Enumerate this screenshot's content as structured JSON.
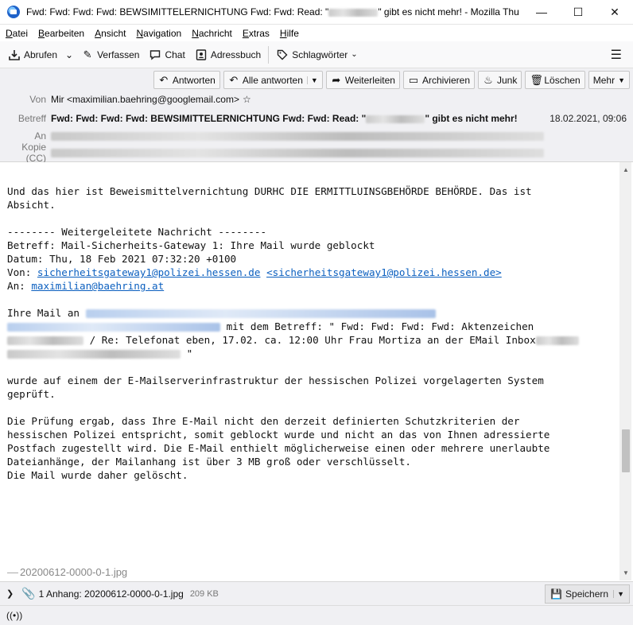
{
  "window": {
    "title_prefix": "Fwd: Fwd: Fwd: Fwd: BEWSIMITTELERNICHTUNG Fwd: Fwd: Read: \"",
    "title_suffix": "\" gibt es nicht mehr! - Mozilla Thun…",
    "minimize": "—",
    "maximize": "☐",
    "close": "✕"
  },
  "menu": [
    "Datei",
    "Bearbeiten",
    "Ansicht",
    "Navigation",
    "Nachricht",
    "Extras",
    "Hilfe"
  ],
  "toolbar": {
    "get_mail": "Abrufen",
    "compose": "Verfassen",
    "chat": "Chat",
    "address_book": "Adressbuch",
    "tags": "Schlagwörter"
  },
  "actions": {
    "reply": "Antworten",
    "reply_all": "Alle antworten",
    "forward": "Weiterleiten",
    "archive": "Archivieren",
    "junk": "Junk",
    "delete": "Löschen",
    "more": "Mehr"
  },
  "header": {
    "from_label": "Von",
    "from_value": "Mir <maximilian.baehring@googlemail.com>",
    "subject_label": "Betreff",
    "subject_prefix": "Fwd: Fwd: Fwd: Fwd: BEWSIMITTELERNICHTUNG Fwd: Fwd: Read: \"",
    "subject_suffix": "\" gibt es nicht mehr!",
    "date": "18.02.2021, 09:06",
    "to_label": "An",
    "cc_label": "Kopie (CC)"
  },
  "body": {
    "p1": "Und das hier ist Beweismittelvernichtung DURHC DIE ERMITTLUINSGBEHÖRDE BEHÖRDE. Das ist\nAbsicht.",
    "fw_header": "-------- Weitergeleitete Nachricht --------",
    "fw_subject": "Betreff: Mail-Sicherheits-Gateway 1: Ihre Mail wurde geblockt",
    "fw_date": "Datum: Thu, 18 Feb 2021 07:32:20 +0100",
    "fw_from_label": "Von: ",
    "fw_from_link1": "sicherheitsgateway1@polizei.hessen.de",
    "fw_from_link2": "<sicherheitsgateway1@polizei.hessen.de>",
    "fw_to_label": "An: ",
    "fw_to_link": "maximilian@baehring.at",
    "mail_to": "Ihre Mail an ",
    "mail_subject_intro": " mit dem Betreff: \" Fwd: Fwd: Fwd: Fwd: Aktenzeichen",
    "mail_subject_line2": " / Re: Telefonat eben, 17.02. ca. 12:00 Uhr Frau Mortiza an der EMail Inbox",
    "mail_subject_close": " \"",
    "p3": "wurde auf einem der E-Mailserverinfrastruktur der hessischen Polizei vorgelagerten System\ngeprüft.",
    "p4": "Die Prüfung ergab, dass Ihre E-Mail nicht den derzeit definierten Schutzkriterien der\nhessischen Polizei entspricht, somit geblockt wurde und nicht an das von Ihnen adressierte\nPostfach zugestellt wird. Die E-Mail enthielt möglicherweise einen oder mehrere unerlaubte\nDateianhänge, der Mailanhang ist über 3 MB groß oder verschlüsselt.\nDie Mail wurde daher gelöscht.",
    "attachment_inline": "20200612-0000-0-1.jpg"
  },
  "attachments": {
    "summary": "1 Anhang: 20200612-0000-0-1.jpg",
    "size": "209 KB",
    "save": "Speichern"
  }
}
